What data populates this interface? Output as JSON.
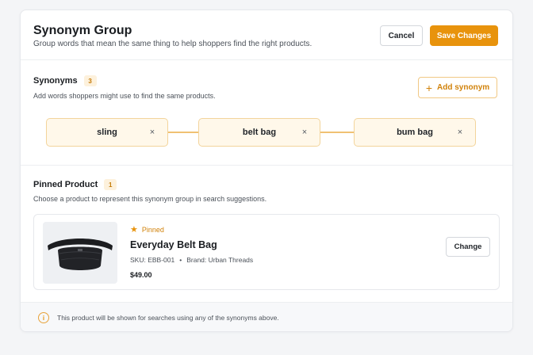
{
  "header": {
    "title": "Synonym Group",
    "subtitle": "Group words that mean the same thing to help shoppers find the right products.",
    "cancel_label": "Cancel",
    "save_label": "Save Changes"
  },
  "synonyms": {
    "title": "Synonyms",
    "count": "3",
    "description": "Add words shoppers might use to find the same products.",
    "add_label": "Add synonym",
    "items": [
      {
        "label": "sling"
      },
      {
        "label": "belt bag"
      },
      {
        "label": "bum bag"
      }
    ],
    "remove_glyph": "×"
  },
  "pinned_product": {
    "title": "Pinned Product",
    "count": "1",
    "description": "Choose a product to represent this synonym group in search suggestions.",
    "status": "Pinned",
    "name": "Everyday Belt Bag",
    "sku": "SKU: EBB-001",
    "brand": "Brand: Urban Threads",
    "price": "$49.00",
    "change_label": "Change"
  },
  "footer": {
    "note": "This product will be shown for searches using any of the synonyms above."
  },
  "colors": {
    "accent": "#e8930c",
    "chip_bg": "#fff8ea",
    "chip_border": "#f3d49b"
  },
  "icons": {
    "add": "plus-icon",
    "remove": "close-icon",
    "pinned": "star-icon",
    "info": "info-icon"
  }
}
